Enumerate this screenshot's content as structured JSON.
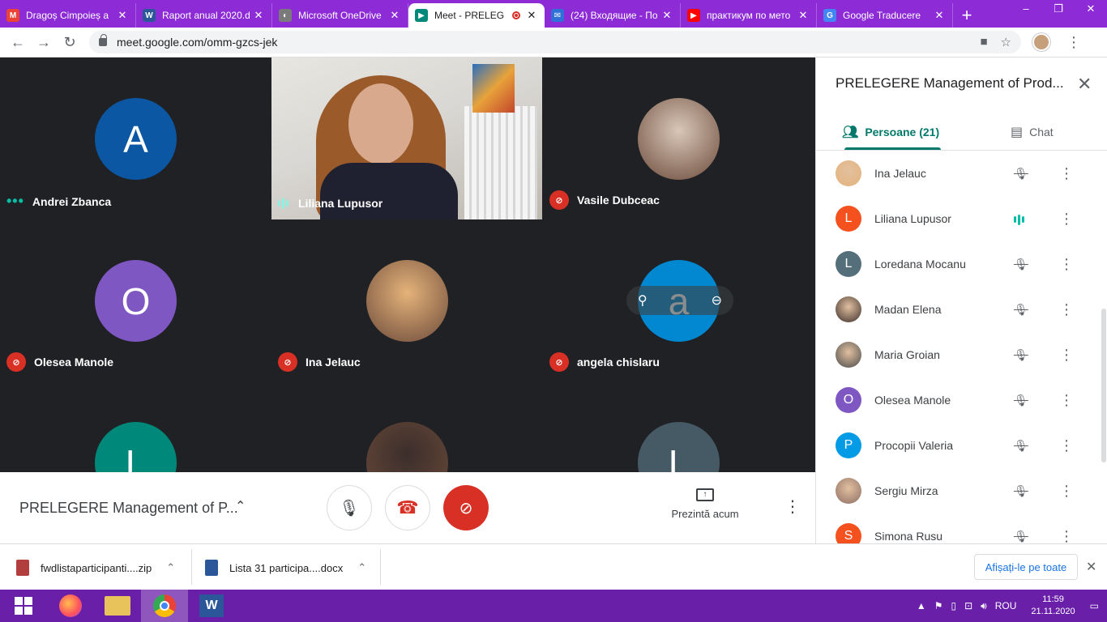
{
  "browser": {
    "tabs": [
      {
        "title": "Dragoș Cimpoieș a",
        "favicon": "gmail-icon",
        "color": "#ea4335",
        "letter": "M"
      },
      {
        "title": "Raport anual 2020.d",
        "favicon": "word-icon",
        "color": "#2b579a",
        "letter": "W"
      },
      {
        "title": "Microsoft OneDrive",
        "favicon": "onedrive-icon",
        "color": "#7a7a7a",
        "letter": "◐"
      },
      {
        "title": "Meet - PRELEG",
        "favicon": "meet-icon",
        "color": "#00897b",
        "letter": "▶",
        "active": true,
        "recording": true
      },
      {
        "title": "(24) Входящие - По",
        "favicon": "mail-icon",
        "color": "#2f6fd8",
        "letter": "✉"
      },
      {
        "title": "практикум по мето",
        "favicon": "youtube-icon",
        "color": "#ff0000",
        "letter": "▶"
      },
      {
        "title": "Google Traducere",
        "favicon": "translate-icon",
        "color": "#4285f4",
        "letter": "G"
      }
    ],
    "url": "meet.google.com/omm-gzcs-jek"
  },
  "meet": {
    "tiles": [
      {
        "name": "Andrei Zbanca",
        "initial": "A",
        "avatar_color": "#0b57a4",
        "status": "dots"
      },
      {
        "name": "Liliana Lupusor",
        "initial": "",
        "avatar_color": "",
        "status": "speaking",
        "video": true
      },
      {
        "name": "Vasile Dubceac",
        "initial": "",
        "avatar_color": "#d9c7b8",
        "status": "muted",
        "photo": true
      },
      {
        "name": "Olesea Manole",
        "initial": "O",
        "avatar_color": "#7e57c2",
        "status": "muted"
      },
      {
        "name": "Ina Jelauc",
        "initial": "",
        "avatar_color": "#e5b37a",
        "status": "muted",
        "photo": true
      },
      {
        "name": "angela chislaru",
        "initial": "a",
        "avatar_color": "#0288d1",
        "status": "muted"
      },
      {
        "name": "",
        "initial": "L",
        "avatar_color": "#00897b",
        "status": "none"
      },
      {
        "name": "",
        "initial": "",
        "avatar_color": "#3b2e2b",
        "status": "none",
        "photo": true
      },
      {
        "name": "",
        "initial": "L",
        "avatar_color": "#455a64",
        "status": "none"
      }
    ],
    "meeting_title": "PRELEGERE Management of P...",
    "present_label": "Prezintă acum"
  },
  "panel": {
    "title": "PRELEGERE Management of Prod...",
    "people_tab": "Persoane (21)",
    "chat_tab": "Chat",
    "people": [
      {
        "name": "Ina Jelauc",
        "initial": "",
        "color": "#e5b37a",
        "speaking": false
      },
      {
        "name": "Liliana Lupusor",
        "initial": "L",
        "color": "#f4511e",
        "speaking": true
      },
      {
        "name": "Loredana Mocanu",
        "initial": "L",
        "color": "#546e7a",
        "speaking": false
      },
      {
        "name": "Madan Elena",
        "initial": "",
        "color": "#3b2e2b",
        "speaking": false
      },
      {
        "name": "Maria Groian",
        "initial": "",
        "color": "#4a4a4a",
        "speaking": false
      },
      {
        "name": "Olesea Manole",
        "initial": "O",
        "color": "#7e57c2",
        "speaking": false
      },
      {
        "name": "Procopii Valeria",
        "initial": "P",
        "color": "#039be5",
        "speaking": false
      },
      {
        "name": "Sergiu Mirza",
        "initial": "",
        "color": "#8d6e63",
        "speaking": false
      },
      {
        "name": "Simona Rusu",
        "initial": "S",
        "color": "#f4511e",
        "speaking": false
      }
    ]
  },
  "downloads": {
    "items": [
      {
        "name": "fwdlistaparticipanti....zip",
        "icon": "zip-icon",
        "color": "#b33e3e"
      },
      {
        "name": "Lista 31 participa....docx",
        "icon": "word-icon",
        "color": "#2b579a"
      }
    ],
    "show_all": "Afișați-le pe toate"
  },
  "taskbar": {
    "lang": "ROU",
    "time": "11:59",
    "date": "21.11.2020"
  }
}
